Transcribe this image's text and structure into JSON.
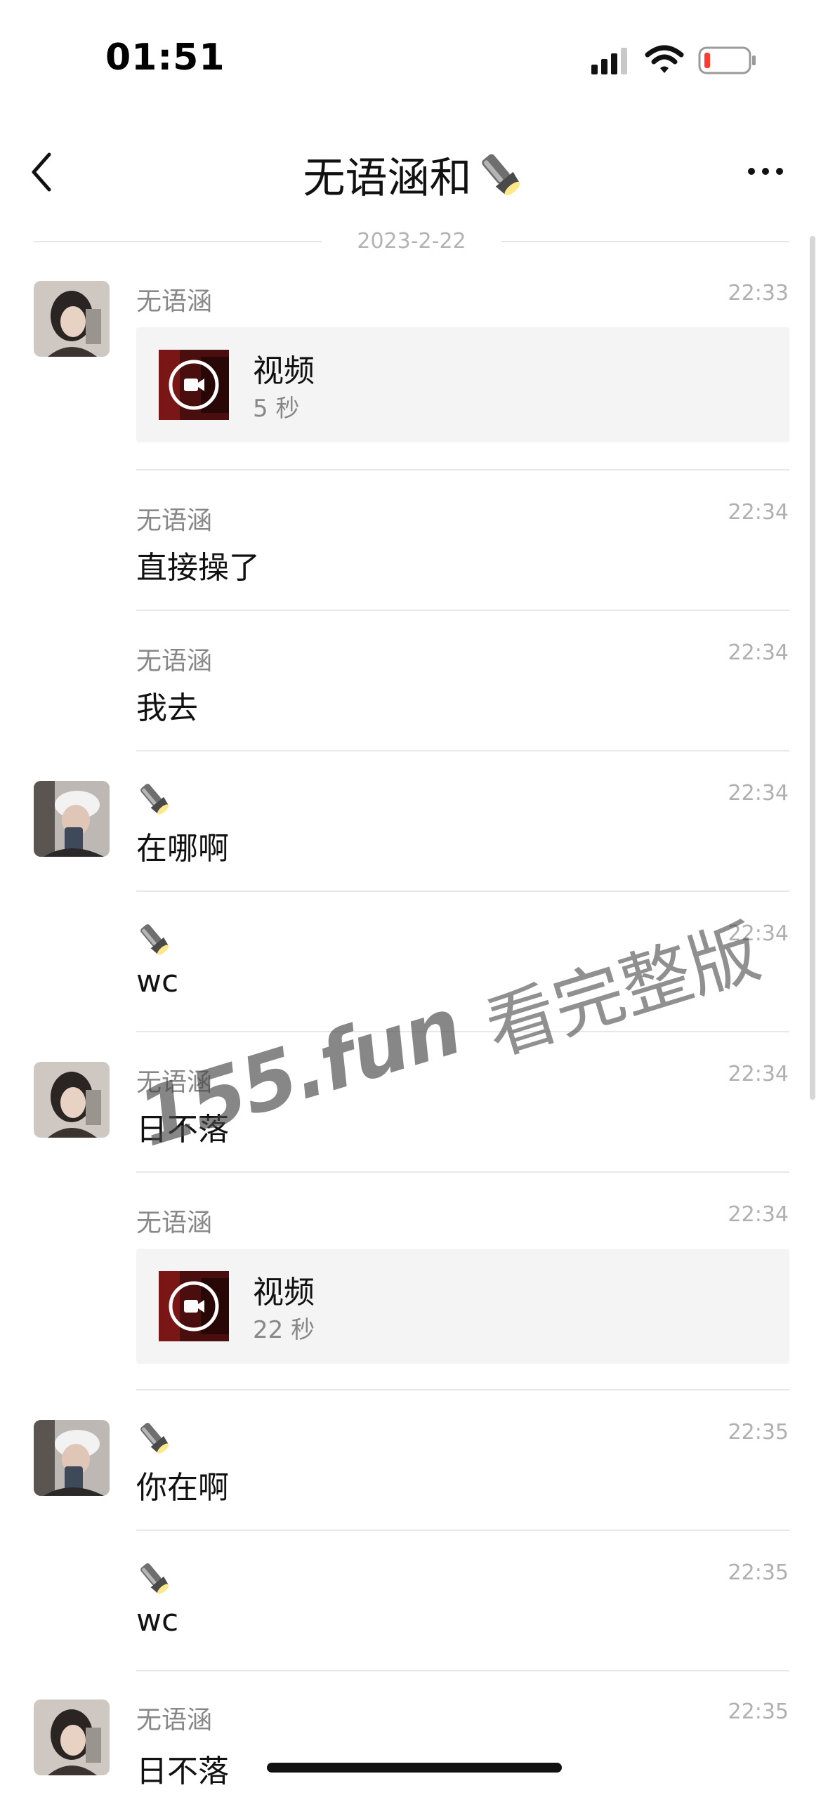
{
  "status": {
    "time": "01:51"
  },
  "header": {
    "title": "无语涵和"
  },
  "date_divider": "2023-2-22",
  "messages": [
    {
      "sender": "无语涵",
      "time": "22:33",
      "video": {
        "label": "视频",
        "duration": "5 秒"
      }
    },
    {
      "sender": "无语涵",
      "time": "22:34",
      "text": "直接操了"
    },
    {
      "sender": "无语涵",
      "time": "22:34",
      "text": "我去"
    },
    {
      "time": "22:34",
      "text": "在哪啊"
    },
    {
      "time": "22:34",
      "text": "wc"
    },
    {
      "sender": "无语涵",
      "time": "22:34",
      "text": "日不落"
    },
    {
      "sender": "无语涵",
      "time": "22:34",
      "video": {
        "label": "视频",
        "duration": "22 秒"
      }
    },
    {
      "time": "22:35",
      "text": "你在啊"
    },
    {
      "time": "22:35",
      "text": "wc"
    },
    {
      "sender": "无语涵",
      "time": "22:35",
      "text": "日不落"
    }
  ],
  "watermark": {
    "url": "155.fun",
    "cta": "看完整版"
  },
  "icons": {
    "sender_icon": "flashlight-icon",
    "back": "chevron-left-icon",
    "more": "more-dots-icon"
  }
}
